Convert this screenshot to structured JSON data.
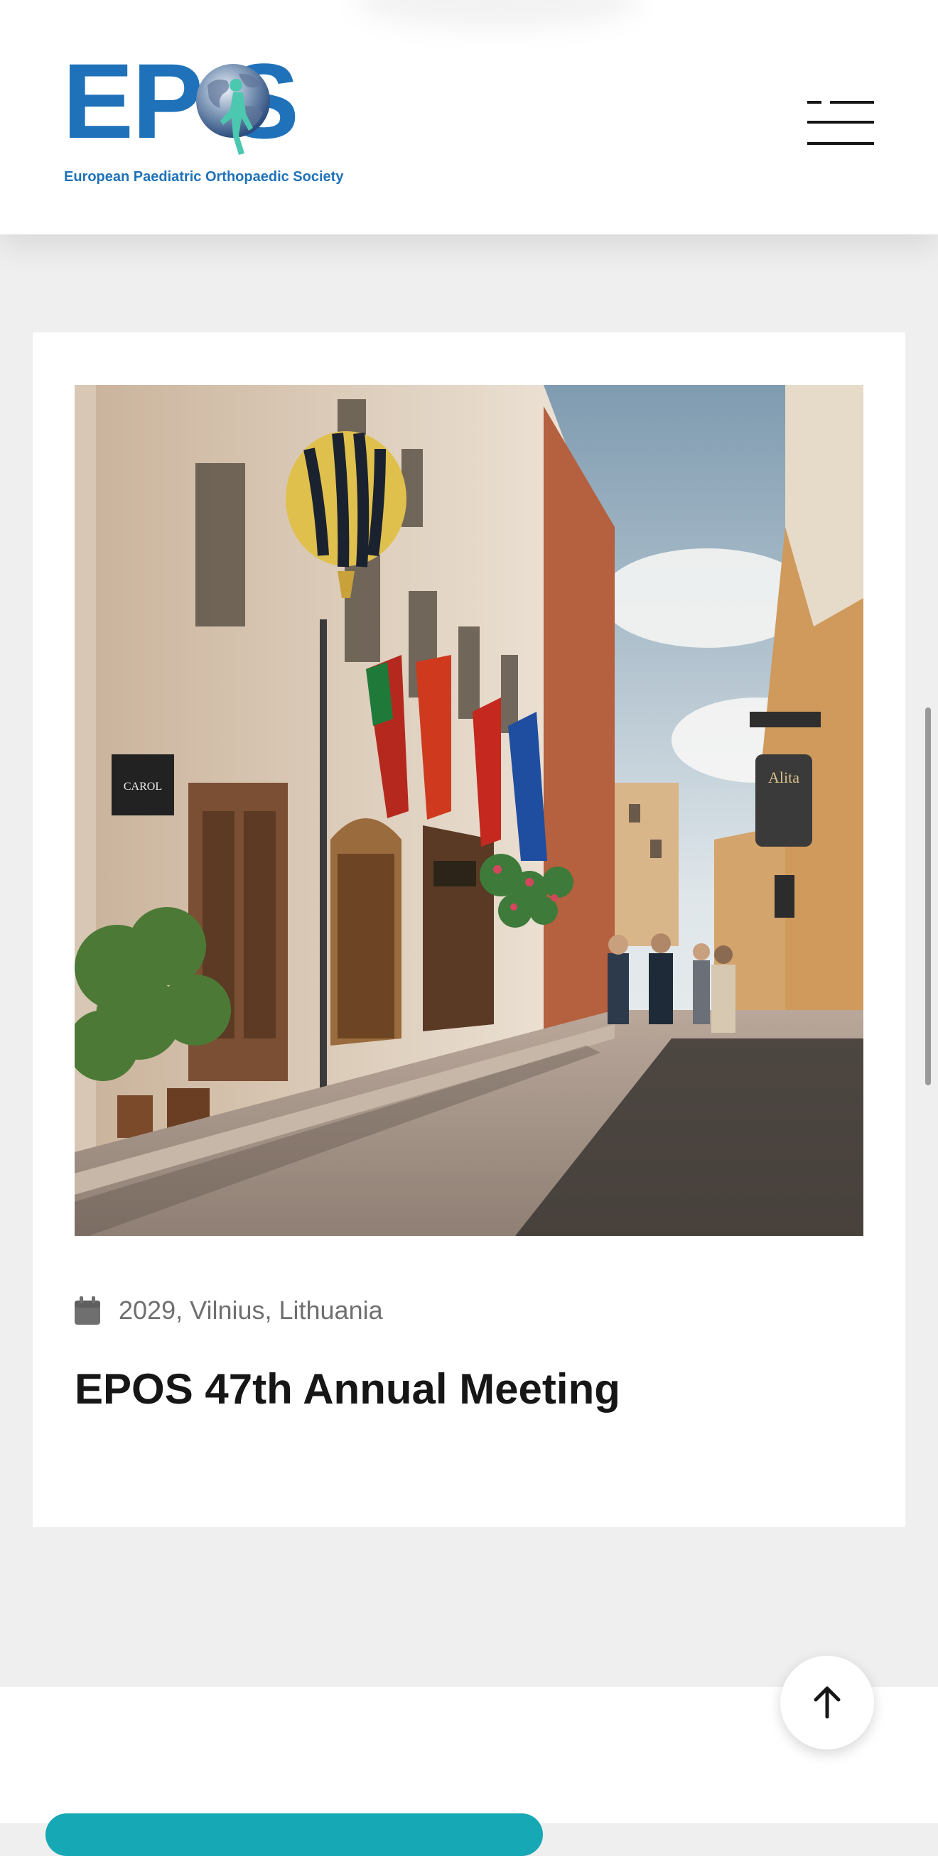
{
  "header": {
    "logo": {
      "letters": "EP S",
      "tagline": "European Paediatric Orthopaedic Society",
      "brand_color": "#1f72b9",
      "figure_color": "#4cc7b0"
    },
    "menu_icon": "hamburger-menu-icon"
  },
  "event_card": {
    "image_description_icon": "vilnius-street-photo",
    "meta_icon": "calendar-icon",
    "meta": "2029, Vilnius, Lithuania",
    "title": "EPOS 47th Annual Meeting"
  },
  "scroll_top": {
    "icon": "arrow-up-icon"
  },
  "colors": {
    "page_background": "#efefef",
    "card_background": "#ffffff",
    "title_text": "#161616",
    "meta_text": "#6f6f6f",
    "accent_teal": "#16a8b5"
  }
}
